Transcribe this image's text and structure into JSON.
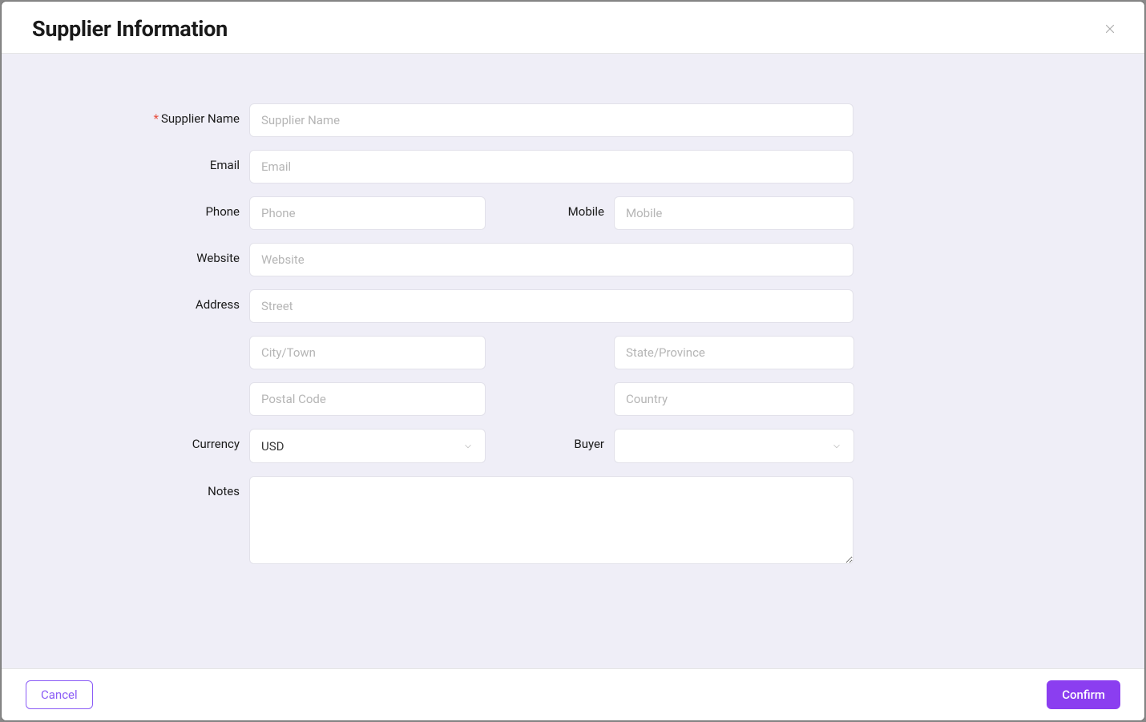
{
  "modal": {
    "title": "Supplier Information"
  },
  "form": {
    "supplier_name": {
      "label": "Supplier Name",
      "placeholder": "Supplier Name",
      "value": "",
      "required": true
    },
    "email": {
      "label": "Email",
      "placeholder": "Email",
      "value": ""
    },
    "phone": {
      "label": "Phone",
      "placeholder": "Phone",
      "value": ""
    },
    "mobile": {
      "label": "Mobile",
      "placeholder": "Mobile",
      "value": ""
    },
    "website": {
      "label": "Website",
      "placeholder": "Website",
      "value": ""
    },
    "address": {
      "label": "Address",
      "street": {
        "placeholder": "Street",
        "value": ""
      },
      "city": {
        "placeholder": "City/Town",
        "value": ""
      },
      "state": {
        "placeholder": "State/Province",
        "value": ""
      },
      "postal": {
        "placeholder": "Postal Code",
        "value": ""
      },
      "country": {
        "placeholder": "Country",
        "value": ""
      }
    },
    "currency": {
      "label": "Currency",
      "value": "USD"
    },
    "buyer": {
      "label": "Buyer",
      "value": ""
    },
    "notes": {
      "label": "Notes",
      "value": ""
    }
  },
  "footer": {
    "cancel_label": "Cancel",
    "confirm_label": "Confirm"
  }
}
